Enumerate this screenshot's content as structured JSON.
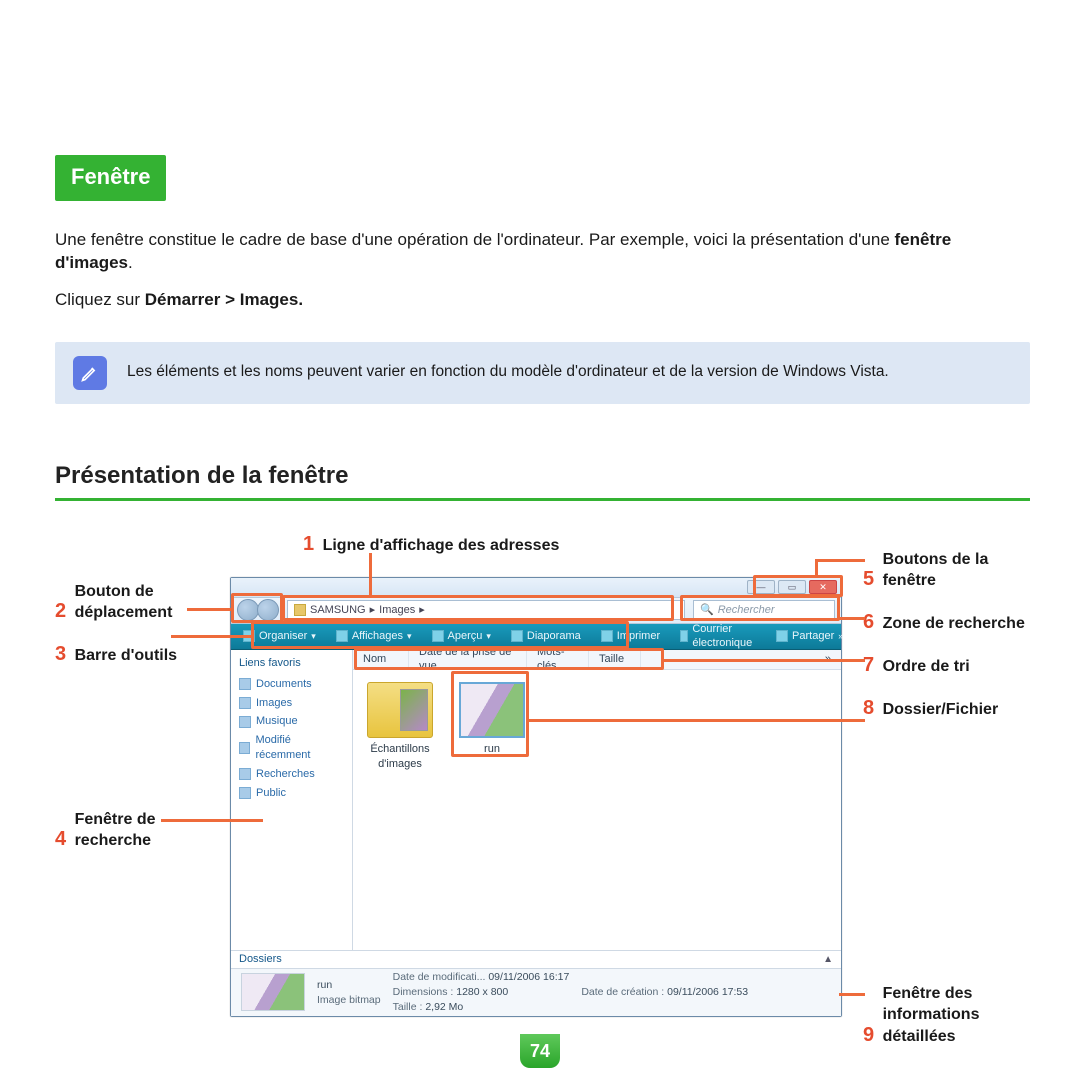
{
  "heading_tag": "Fenêtre",
  "intro": {
    "sentence1_pre": "Une fenêtre constitue le cadre de base d'une opération de l'ordinateur. Par exemple, voici la présentation d'une ",
    "sentence1_bold": "fenêtre d'images",
    "sentence1_post": ".",
    "sentence2_pre": "Cliquez sur ",
    "sentence2_bold": "Démarrer > Images."
  },
  "notebox": "Les éléments et les noms peuvent varier en fonction du modèle d'ordinateur et de la version de Windows Vista.",
  "section_title": "Présentation de la fenêtre",
  "callouts": {
    "c1": {
      "num": "1",
      "text": "Ligne d'affichage des adresses"
    },
    "c2": {
      "num": "2",
      "text": "Bouton de déplacement"
    },
    "c3": {
      "num": "3",
      "text": "Barre d'outils"
    },
    "c4": {
      "num": "4",
      "text": "Fenêtre de recherche"
    },
    "c5": {
      "num": "5",
      "text": "Boutons de la fenêtre"
    },
    "c6": {
      "num": "6",
      "text": "Zone de recherche"
    },
    "c7": {
      "num": "7",
      "text": "Ordre de tri"
    },
    "c8": {
      "num": "8",
      "text": "Dossier/Fichier"
    },
    "c9": {
      "num": "9",
      "text": "Fenêtre des informations détaillées"
    }
  },
  "explorer": {
    "breadcrumb": {
      "seg1": "SAMSUNG",
      "seg2": "Images",
      "sep": "▸"
    },
    "search_placeholder": "Rechercher",
    "toolbar": {
      "organiser": "Organiser",
      "affichages": "Affichages",
      "apercu": "Aperçu",
      "diaporama": "Diaporama",
      "imprimer": "Imprimer",
      "courrier": "Courrier électronique",
      "partager": "Partager"
    },
    "sidebar": {
      "header": "Liens favoris",
      "items": [
        "Documents",
        "Images",
        "Musique",
        "Modifié récemment",
        "Recherches",
        "Public"
      ]
    },
    "columns": {
      "nom": "Nom",
      "date": "Date de la prise de vue",
      "mots": "Mots-clés",
      "taille": "Taille"
    },
    "files": {
      "item1": "Échantillons d'images",
      "item2": "run"
    },
    "folders_label": "Dossiers",
    "details": {
      "name": "run",
      "type": "Image bitmap",
      "mod_label": "Date de modificati...",
      "mod_value": "09/11/2006 16:17",
      "dim_label": "Dimensions :",
      "dim_value": "1280 x 800",
      "size_label": "Taille :",
      "size_value": "2,92 Mo",
      "created_label": "Date de création :",
      "created_value": "09/11/2006 17:53"
    },
    "winbtns": {
      "min": "—",
      "max": "▭",
      "close": "✕"
    }
  },
  "page_number": "74"
}
